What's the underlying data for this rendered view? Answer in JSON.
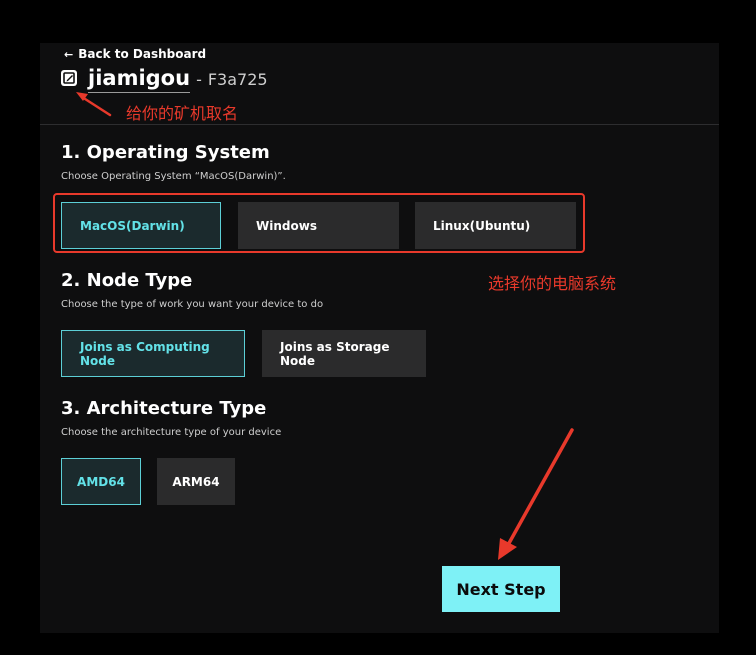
{
  "header": {
    "back_label": "Back to Dashboard",
    "device_name": "jiamigou",
    "separator": "-",
    "device_id": "F3a725"
  },
  "annotations": {
    "rename": "给你的矿机取名",
    "choose_os": "选择你的电脑系统"
  },
  "sections": {
    "os": {
      "title": "1. Operating System",
      "description": "Choose Operating System “MacOS(Darwin)”.",
      "options": [
        "MacOS(Darwin)",
        "Windows",
        "Linux(Ubuntu)"
      ],
      "selected": "MacOS(Darwin)"
    },
    "node": {
      "title": "2. Node Type",
      "description": "Choose the type of work you want your device to do",
      "options": [
        "Joins as Computing Node",
        "Joins as Storage Node"
      ],
      "selected": "Joins as Computing Node"
    },
    "arch": {
      "title": "3. Architecture Type",
      "description": "Choose the architecture type of your device",
      "options": [
        "AMD64",
        "ARM64"
      ],
      "selected": "AMD64"
    }
  },
  "footer": {
    "next_label": "Next Step"
  },
  "colors": {
    "accent": "#63e2e8",
    "next_button": "#7ef1f6",
    "annotation": "#e8392b",
    "background": "#0e0e0f"
  }
}
